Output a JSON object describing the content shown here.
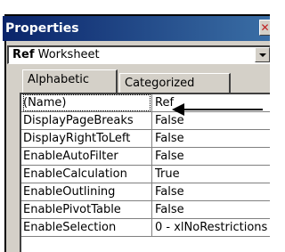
{
  "window": {
    "title": "Properties"
  },
  "object_selector": {
    "name": "Ref",
    "type": "Worksheet"
  },
  "tabs": [
    {
      "label": "Alphabetic",
      "active": true
    },
    {
      "label": "Categorized",
      "active": false
    }
  ],
  "properties": [
    {
      "name": "(Name)",
      "value": "Ref"
    },
    {
      "name": "DisplayPageBreaks",
      "value": "False"
    },
    {
      "name": "DisplayRightToLeft",
      "value": "False"
    },
    {
      "name": "EnableAutoFilter",
      "value": "False"
    },
    {
      "name": "EnableCalculation",
      "value": "True"
    },
    {
      "name": "EnableOutlining",
      "value": "False"
    },
    {
      "name": "EnablePivotTable",
      "value": "False"
    },
    {
      "name": "EnableSelection",
      "value": "0 - xlNoRestrictions"
    }
  ]
}
